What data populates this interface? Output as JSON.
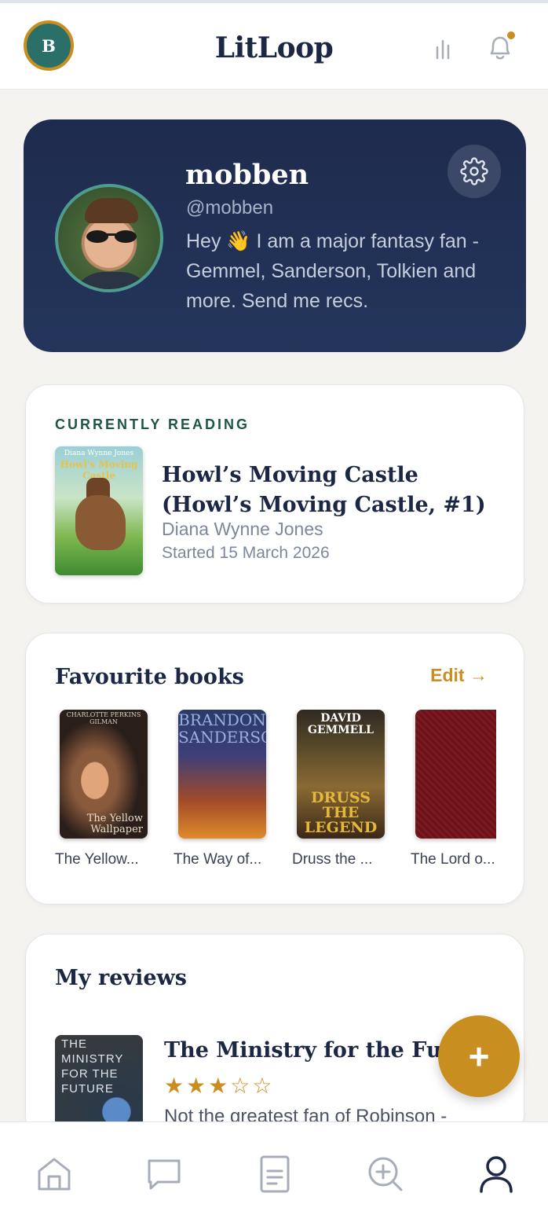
{
  "header": {
    "avatar_initial": "B",
    "title": "LitLoop",
    "stats_icon": "bar-chart-icon",
    "notifications_icon": "bell-icon",
    "accent_color": "#c98e20"
  },
  "profile": {
    "name": "mobben",
    "handle": "@mobben",
    "bio": "Hey 👋 I am a major fantasy fan - Gemmel, Sanderson, Tolkien and more. Send me recs.",
    "settings_icon": "gear-icon"
  },
  "currently_reading": {
    "label": "CURRENTLY READING",
    "cover_author": "Diana Wynne Jones",
    "cover_title": "Howl's Moving Castle",
    "title": "Howl’s Moving Castle (Howl’s Moving Castle, #1)",
    "author": "Diana Wynne Jones",
    "started": "Started 15 March 2026"
  },
  "favourites": {
    "heading": "Favourite books",
    "edit_label": "Edit →",
    "books": [
      {
        "label": "The Yellow...",
        "cover_top": "CHARLOTTE PERKINS GILMAN",
        "cover_title": "The Yellow Wallpaper"
      },
      {
        "label": "The Way of...",
        "cover_top": "BRANDON SANDERSON"
      },
      {
        "label": "Druss the ...",
        "cover_top": "DAVID GEMMELL",
        "cover_title": "DRUSS THE LEGEND"
      },
      {
        "label": "The Lord o..."
      }
    ]
  },
  "reviews": {
    "heading": "My reviews",
    "items": [
      {
        "cover_title": "THE MINISTRY FOR THE FUTURE",
        "title": "The Ministry for the Future",
        "rating": 3,
        "max_rating": 5,
        "stars": "★★★☆☆",
        "excerpt": "Not the greatest fan of Robinson -"
      }
    ]
  },
  "fab": {
    "label": "+"
  },
  "nav": {
    "items": [
      {
        "name": "home",
        "icon": "home-icon",
        "active": false
      },
      {
        "name": "messages",
        "icon": "chat-icon",
        "active": false
      },
      {
        "name": "library",
        "icon": "book-icon",
        "active": false
      },
      {
        "name": "discover",
        "icon": "search-plus-icon",
        "active": false
      },
      {
        "name": "profile",
        "icon": "user-icon",
        "active": true
      }
    ]
  }
}
